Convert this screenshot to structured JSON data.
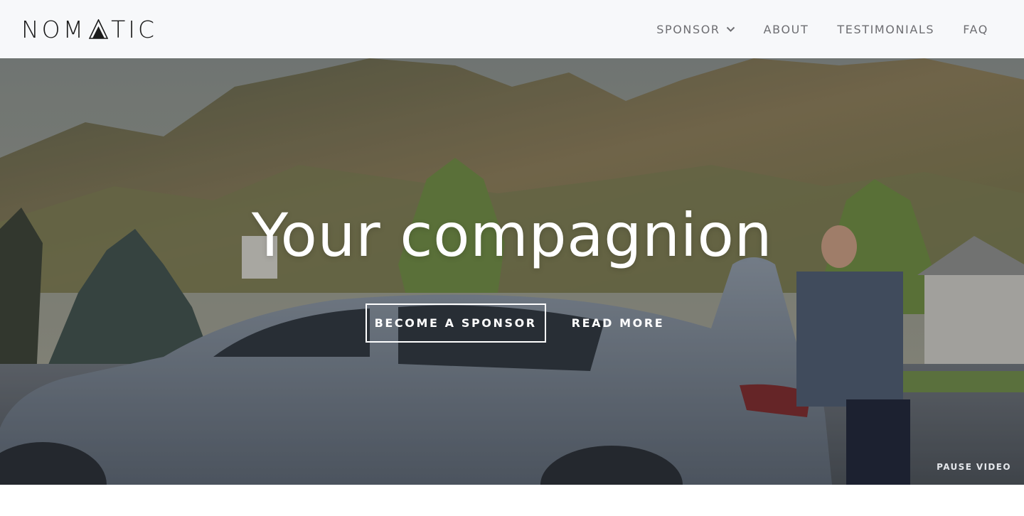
{
  "header": {
    "logo_text_left": "NOM",
    "logo_text_right": "TIC",
    "nav": [
      {
        "label": "SPONSOR",
        "has_dropdown": true
      },
      {
        "label": "ABOUT"
      },
      {
        "label": "TESTIMONIALS"
      },
      {
        "label": "FAQ"
      }
    ]
  },
  "hero": {
    "headline": "Your compagnion",
    "primary_button": "BECOME A SPONSOR",
    "secondary_button": "READ MORE",
    "pause_video": "PAUSE VIDEO"
  },
  "colors": {
    "header_bg": "#f7f8fa",
    "nav_text": "#6e6e72",
    "logo": "#1b1b1b",
    "hero_text": "#ffffff"
  },
  "icons": {
    "logo_triangle": "triangle-icon",
    "dropdown": "chevron-down-icon"
  }
}
